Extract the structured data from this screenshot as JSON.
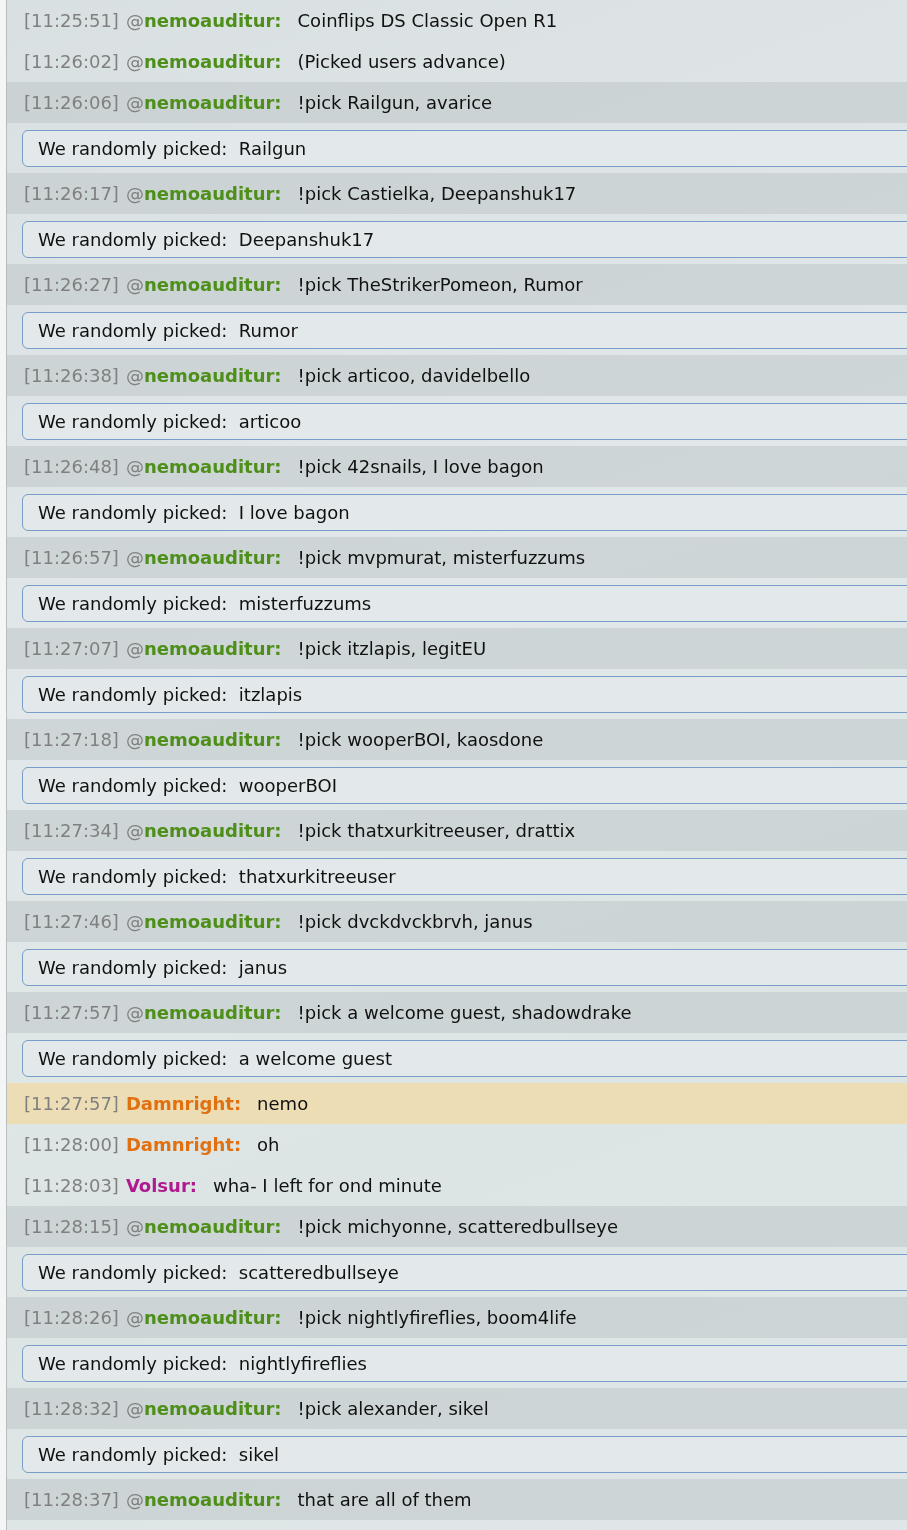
{
  "messages": [
    {
      "kind": "chat",
      "time": "[11:25:51]",
      "rank": "@",
      "user": "nemoauditur:",
      "color": "#4e8f1a",
      "text": "Coinflips DS Classic Open R1"
    },
    {
      "kind": "chat",
      "time": "[11:26:02]",
      "rank": "@",
      "user": "nemoauditur:",
      "color": "#4e8f1a",
      "text": "(Picked users advance)"
    },
    {
      "kind": "command",
      "time": "[11:26:06]",
      "rank": "@",
      "user": "nemoauditur:",
      "color": "#4e8f1a",
      "text": "!pick Railgun, avarice"
    },
    {
      "kind": "bot",
      "text": "We randomly picked:  Railgun"
    },
    {
      "kind": "command",
      "time": "[11:26:17]",
      "rank": "@",
      "user": "nemoauditur:",
      "color": "#4e8f1a",
      "text": "!pick Castielka, Deepanshuk17"
    },
    {
      "kind": "bot",
      "text": "We randomly picked:  Deepanshuk17"
    },
    {
      "kind": "command",
      "time": "[11:26:27]",
      "rank": "@",
      "user": "nemoauditur:",
      "color": "#4e8f1a",
      "text": "!pick TheStrikerPomeon, Rumor"
    },
    {
      "kind": "bot",
      "text": "We randomly picked:  Rumor"
    },
    {
      "kind": "command",
      "time": "[11:26:38]",
      "rank": "@",
      "user": "nemoauditur:",
      "color": "#4e8f1a",
      "text": "!pick articoo, davidelbello"
    },
    {
      "kind": "bot",
      "text": "We randomly picked:  articoo"
    },
    {
      "kind": "command",
      "time": "[11:26:48]",
      "rank": "@",
      "user": "nemoauditur:",
      "color": "#4e8f1a",
      "text": "!pick 42snails, I love bagon"
    },
    {
      "kind": "bot",
      "text": "We randomly picked:  I love bagon"
    },
    {
      "kind": "command",
      "time": "[11:26:57]",
      "rank": "@",
      "user": "nemoauditur:",
      "color": "#4e8f1a",
      "text": "!pick mvpmurat, misterfuzzums"
    },
    {
      "kind": "bot",
      "text": "We randomly picked:  misterfuzzums"
    },
    {
      "kind": "command",
      "time": "[11:27:07]",
      "rank": "@",
      "user": "nemoauditur:",
      "color": "#4e8f1a",
      "text": "!pick itzlapis, legitEU"
    },
    {
      "kind": "bot",
      "text": "We randomly picked:  itzlapis"
    },
    {
      "kind": "command",
      "time": "[11:27:18]",
      "rank": "@",
      "user": "nemoauditur:",
      "color": "#4e8f1a",
      "text": "!pick wooperBOI, kaosdone"
    },
    {
      "kind": "bot",
      "text": "We randomly picked:  wooperBOI"
    },
    {
      "kind": "command",
      "time": "[11:27:34]",
      "rank": "@",
      "user": "nemoauditur:",
      "color": "#4e8f1a",
      "text": "!pick thatxurkitreeuser, drattix"
    },
    {
      "kind": "bot",
      "text": "We randomly picked:  thatxurkitreeuser"
    },
    {
      "kind": "command",
      "time": "[11:27:46]",
      "rank": "@",
      "user": "nemoauditur:",
      "color": "#4e8f1a",
      "text": "!pick dvckdvckbrvh, janus"
    },
    {
      "kind": "bot",
      "text": "We randomly picked:  janus"
    },
    {
      "kind": "command",
      "time": "[11:27:57]",
      "rank": "@",
      "user": "nemoauditur:",
      "color": "#4e8f1a",
      "text": "!pick a welcome guest, shadowdrake"
    },
    {
      "kind": "bot",
      "text": "We randomly picked:  a welcome guest"
    },
    {
      "kind": "mention",
      "time": "[11:27:57]",
      "user": "Damnright:",
      "color": "#e07010",
      "text": "nemo"
    },
    {
      "kind": "chat",
      "time": "[11:28:00]",
      "user": "Damnright:",
      "color": "#e07010",
      "text": "oh"
    },
    {
      "kind": "chat",
      "time": "[11:28:03]",
      "user": "Volsur:",
      "color": "#b01a90",
      "text": "wha- I left for ond minute"
    },
    {
      "kind": "command",
      "time": "[11:28:15]",
      "rank": "@",
      "user": "nemoauditur:",
      "color": "#4e8f1a",
      "text": "!pick michyonne, scatteredbullseye"
    },
    {
      "kind": "bot",
      "text": "We randomly picked:  scatteredbullseye"
    },
    {
      "kind": "command",
      "time": "[11:28:26]",
      "rank": "@",
      "user": "nemoauditur:",
      "color": "#4e8f1a",
      "text": "!pick nightlyfireflies, boom4life"
    },
    {
      "kind": "bot",
      "text": "We randomly picked:  nightlyfireflies"
    },
    {
      "kind": "command",
      "time": "[11:28:32]",
      "rank": "@",
      "user": "nemoauditur:",
      "color": "#4e8f1a",
      "text": "!pick alexander, sikel"
    },
    {
      "kind": "bot",
      "text": "We randomly picked:  sikel"
    },
    {
      "kind": "command",
      "time": "[11:28:37]",
      "rank": "@",
      "user": "nemoauditur:",
      "color": "#4e8f1a",
      "text": "that are all of them"
    }
  ]
}
